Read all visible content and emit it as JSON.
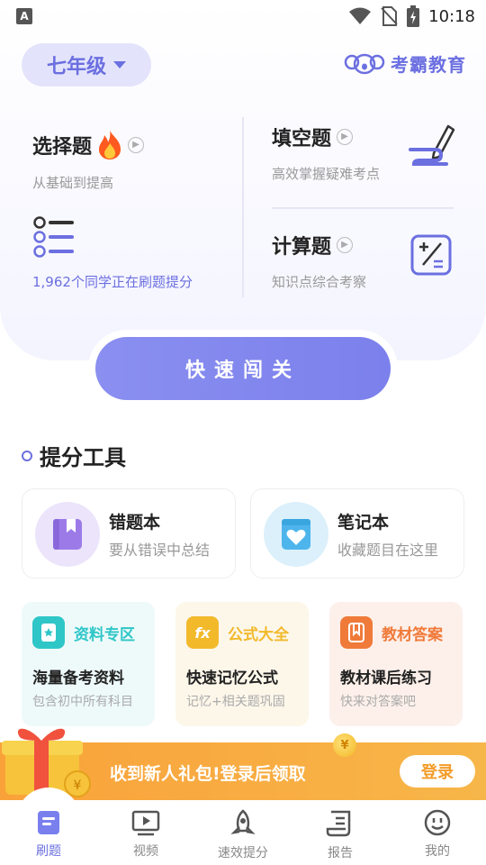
{
  "status_bar": {
    "time": "10:18"
  },
  "header": {
    "grade": "七年级",
    "brand": "考霸教育"
  },
  "practice": {
    "choice": {
      "title": "选择题",
      "subtitle": "从基础到提高"
    },
    "fill": {
      "title": "填空题",
      "subtitle": "高效掌握疑难考点"
    },
    "calc": {
      "title": "计算题",
      "subtitle": "知识点综合考察"
    },
    "learners_text": "1,962个同学正在刷题提分",
    "quick_button": "快速闯关"
  },
  "tools": {
    "section_title": "提分工具",
    "mistakes": {
      "title": "错题本",
      "subtitle": "要从错误中总结"
    },
    "notes": {
      "title": "笔记本",
      "subtitle": "收藏题目在这里"
    }
  },
  "resources": [
    {
      "tag": "资料专区",
      "title": "海量备考资料",
      "subtitle": "包含初中所有科目",
      "color": "#2fc6c8"
    },
    {
      "tag": "公式大全",
      "title": "快速记忆公式",
      "subtitle": "记忆+相关题巩固",
      "color": "#f2b92b"
    },
    {
      "tag": "教材答案",
      "title": "教材课后练习",
      "subtitle": "快来对答案吧",
      "color": "#f07a3a"
    }
  ],
  "banner": {
    "message": "收到新人礼包!登录后领取",
    "login": "登录"
  },
  "nav": [
    {
      "label": "刷题",
      "icon": "book-icon",
      "active": true
    },
    {
      "label": "视频",
      "icon": "video-icon",
      "active": false
    },
    {
      "label": "速效提分",
      "icon": "rocket-icon",
      "active": false
    },
    {
      "label": "报告",
      "icon": "report-icon",
      "active": false
    },
    {
      "label": "我的",
      "icon": "smile-icon",
      "active": false
    }
  ],
  "colors": {
    "accent": "#6b6fe0",
    "banner": "#f9a23a"
  }
}
